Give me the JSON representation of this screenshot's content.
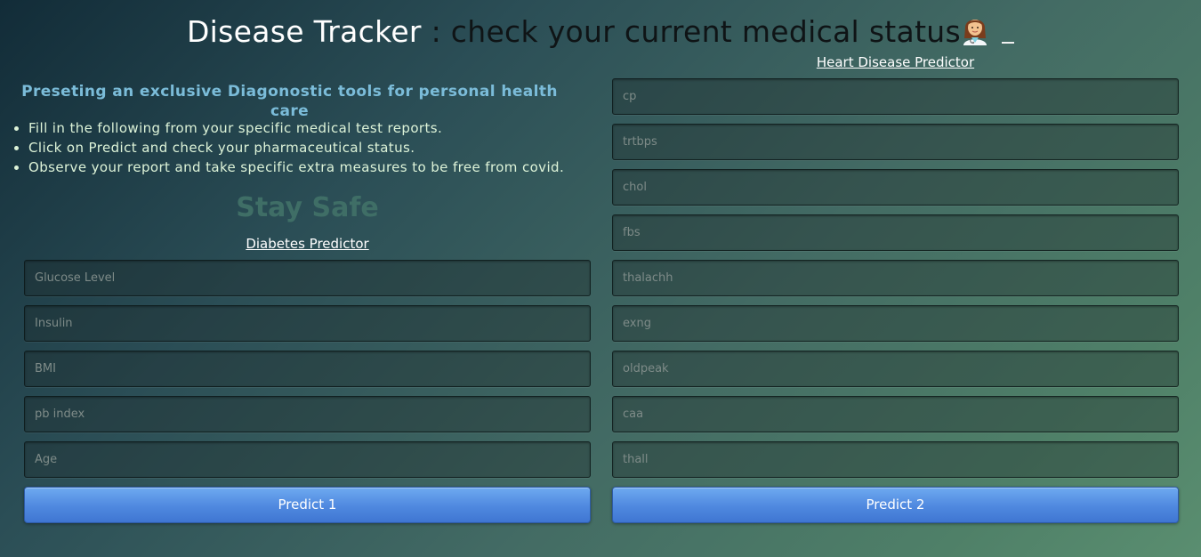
{
  "header": {
    "title_part1": "Disease Tracker",
    "title_part2": " : check your current medical status"
  },
  "intro": {
    "tagline": "Preseting an exclusive Diagonostic tools for personal health care",
    "bullets": [
      "Fill in the following from your specific medical test reports.",
      "Click on Predict and check your pharmaceutical status.",
      "Observe your report and take specific extra measures to be free from covid."
    ],
    "stay_safe": "Stay Safe"
  },
  "diabetes": {
    "title": "Diabetes Predictor",
    "fields": [
      {
        "placeholder": "Glucose Level",
        "value": ""
      },
      {
        "placeholder": "Insulin",
        "value": ""
      },
      {
        "placeholder": "BMI",
        "value": ""
      },
      {
        "placeholder": "pb index",
        "value": ""
      },
      {
        "placeholder": "Age",
        "value": ""
      }
    ],
    "button_label": "Predict 1"
  },
  "heart": {
    "title": "Heart Disease Predictor",
    "fields": [
      {
        "placeholder": "cp",
        "value": ""
      },
      {
        "placeholder": "trtbps",
        "value": ""
      },
      {
        "placeholder": "chol",
        "value": ""
      },
      {
        "placeholder": "fbs",
        "value": ""
      },
      {
        "placeholder": "thalachh",
        "value": ""
      },
      {
        "placeholder": "exng",
        "value": ""
      },
      {
        "placeholder": "oldpeak",
        "value": ""
      },
      {
        "placeholder": "caa",
        "value": ""
      },
      {
        "placeholder": "thall",
        "value": ""
      }
    ],
    "button_label": "Predict 2"
  },
  "icons": {
    "title_emoji": "woman-health-worker-icon"
  },
  "colors": {
    "tagline": "#7bbcd9",
    "bullets": "#ddf3d8",
    "stay_safe": "#3f6e66",
    "button": "#4f88df"
  }
}
